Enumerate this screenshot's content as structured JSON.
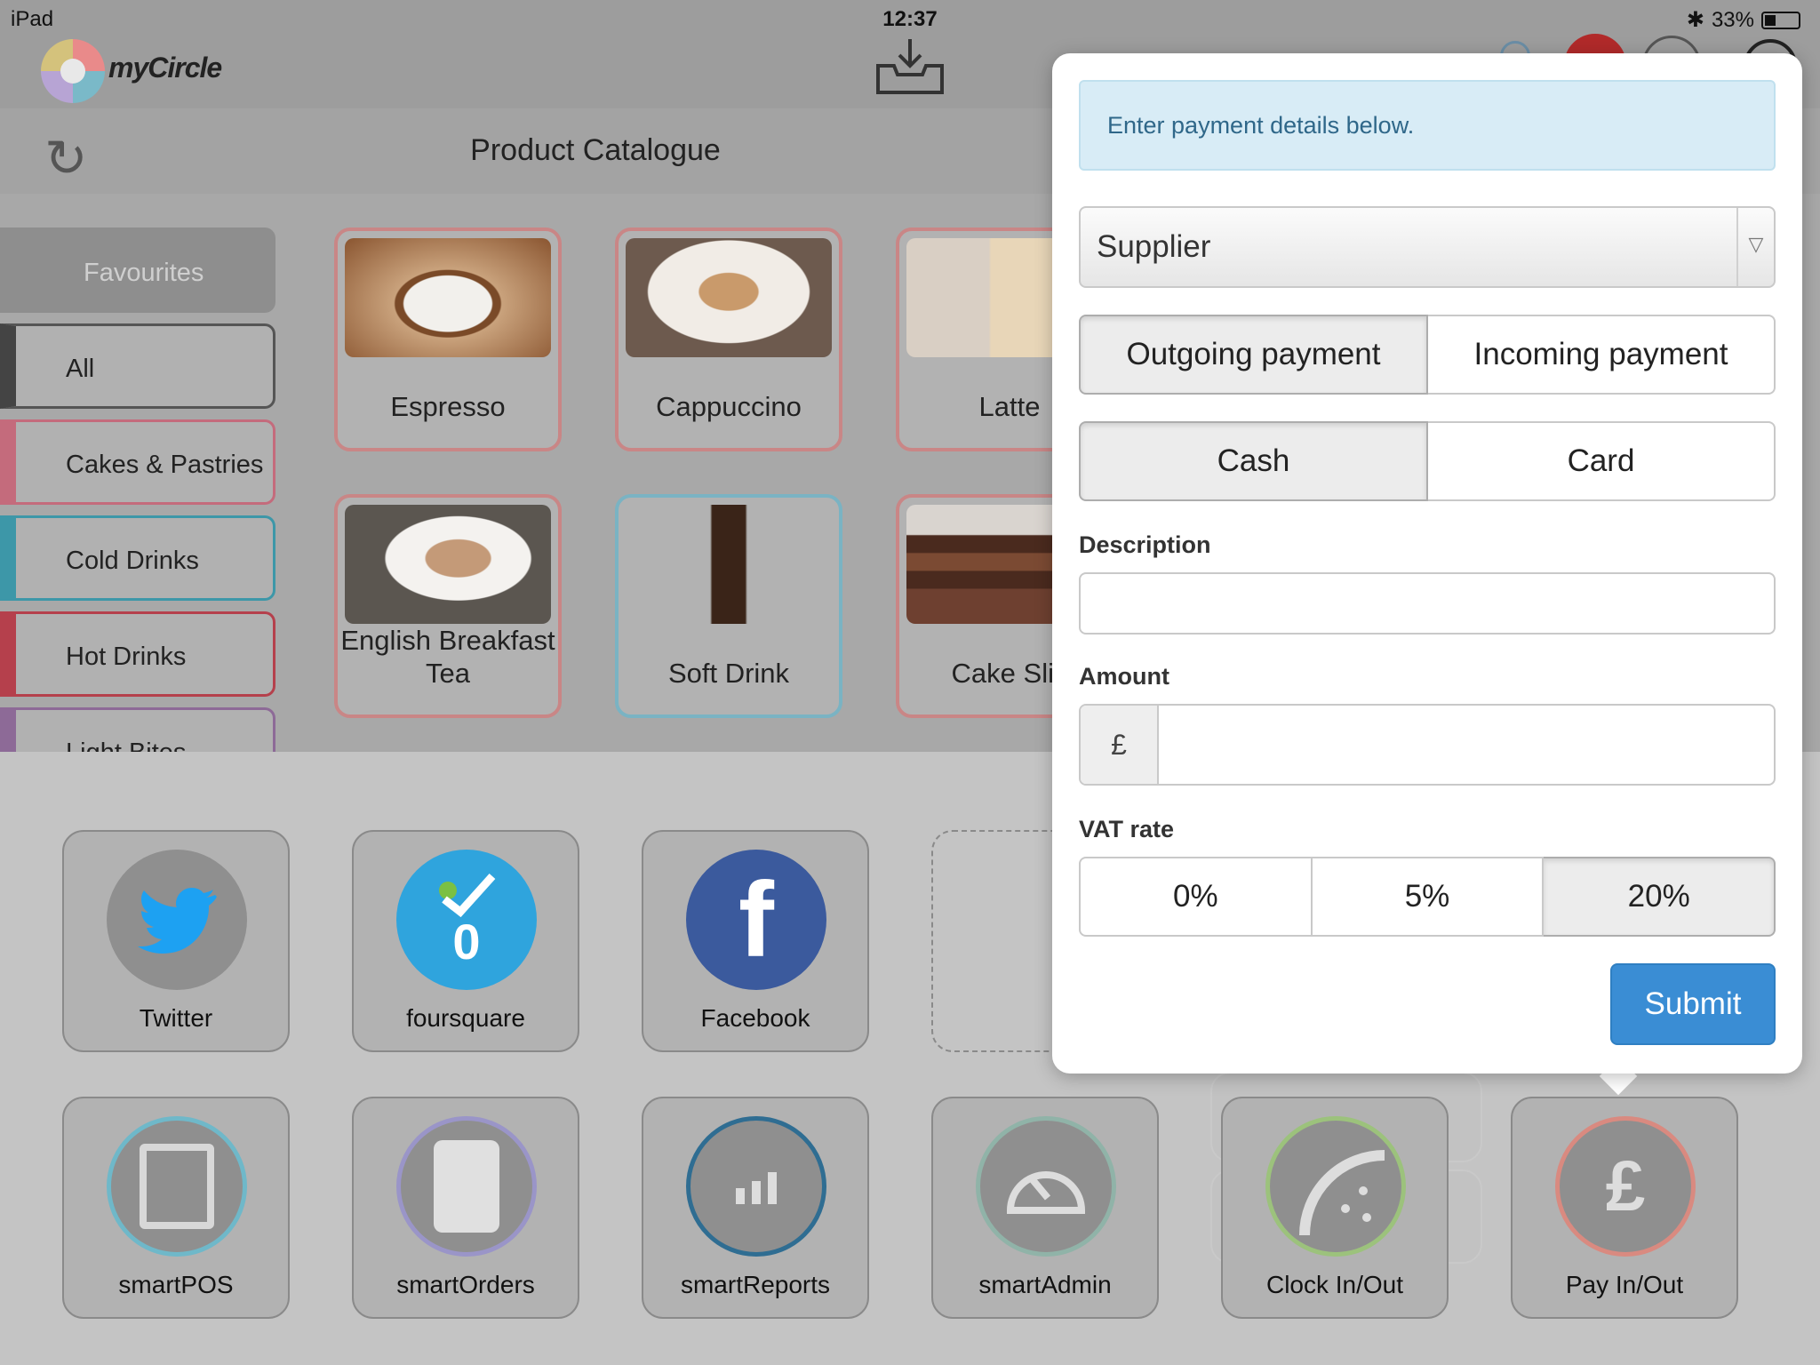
{
  "status_bar": {
    "device": "iPad",
    "time": "12:37",
    "battery": "33%"
  },
  "header": {
    "app_name": "myCircle"
  },
  "catalogue": {
    "title": "Product Catalogue",
    "categories": [
      {
        "label": "Favourites",
        "color": "#8e8e8e"
      },
      {
        "label": "All",
        "color": "#444444"
      },
      {
        "label": "Cakes & Pastries",
        "color": "#c46b7c"
      },
      {
        "label": "Cold Drinks",
        "color": "#3d97a8"
      },
      {
        "label": "Hot Drinks",
        "color": "#b5404c"
      },
      {
        "label": "Light Bites",
        "color": "#8d6a97"
      }
    ],
    "products": [
      {
        "name": "Espresso"
      },
      {
        "name": "Cappuccino"
      },
      {
        "name": "Latte"
      },
      {
        "name": "English Breakfast Tea"
      },
      {
        "name": "Soft Drink"
      },
      {
        "name": "Cake Slic"
      }
    ]
  },
  "dock": {
    "social": [
      {
        "label": "Twitter",
        "icon": "twitter-bird-icon"
      },
      {
        "label": "foursquare",
        "icon": "foursquare-checkin-icon",
        "count": "0"
      },
      {
        "label": "Facebook",
        "icon": "facebook-f-icon"
      }
    ],
    "apps": [
      {
        "label": "smartPOS",
        "icon": "tablet-icon",
        "ring": "#6fb8c9"
      },
      {
        "label": "smartOrders",
        "icon": "order-list-icon",
        "ring": "#9a95c8"
      },
      {
        "label": "smartReports",
        "icon": "bar-chart-icon",
        "ring": "#2f6d92"
      },
      {
        "label": "smartAdmin",
        "icon": "gauge-icon",
        "ring": "#90b3a8"
      },
      {
        "label": "Clock In/Out",
        "icon": "clock-icon",
        "ring": "#9cc27c"
      },
      {
        "label": "Pay In/Out",
        "icon": "pound-plus-minus-icon",
        "ring": "#d98a80"
      }
    ]
  },
  "payment": {
    "alert": "Enter payment details below.",
    "payee_select": "Supplier",
    "direction": {
      "outgoing": "Outgoing payment",
      "incoming": "Incoming payment",
      "selected": "Outgoing payment"
    },
    "method": {
      "cash": "Cash",
      "card": "Card",
      "selected": "Cash"
    },
    "description_label": "Description",
    "description_value": "",
    "amount_label": "Amount",
    "currency_symbol": "£",
    "amount_value": "",
    "vat_label": "VAT rate",
    "vat_options": [
      "0%",
      "5%",
      "20%"
    ],
    "vat_selected": "20%",
    "submit": "Submit"
  }
}
